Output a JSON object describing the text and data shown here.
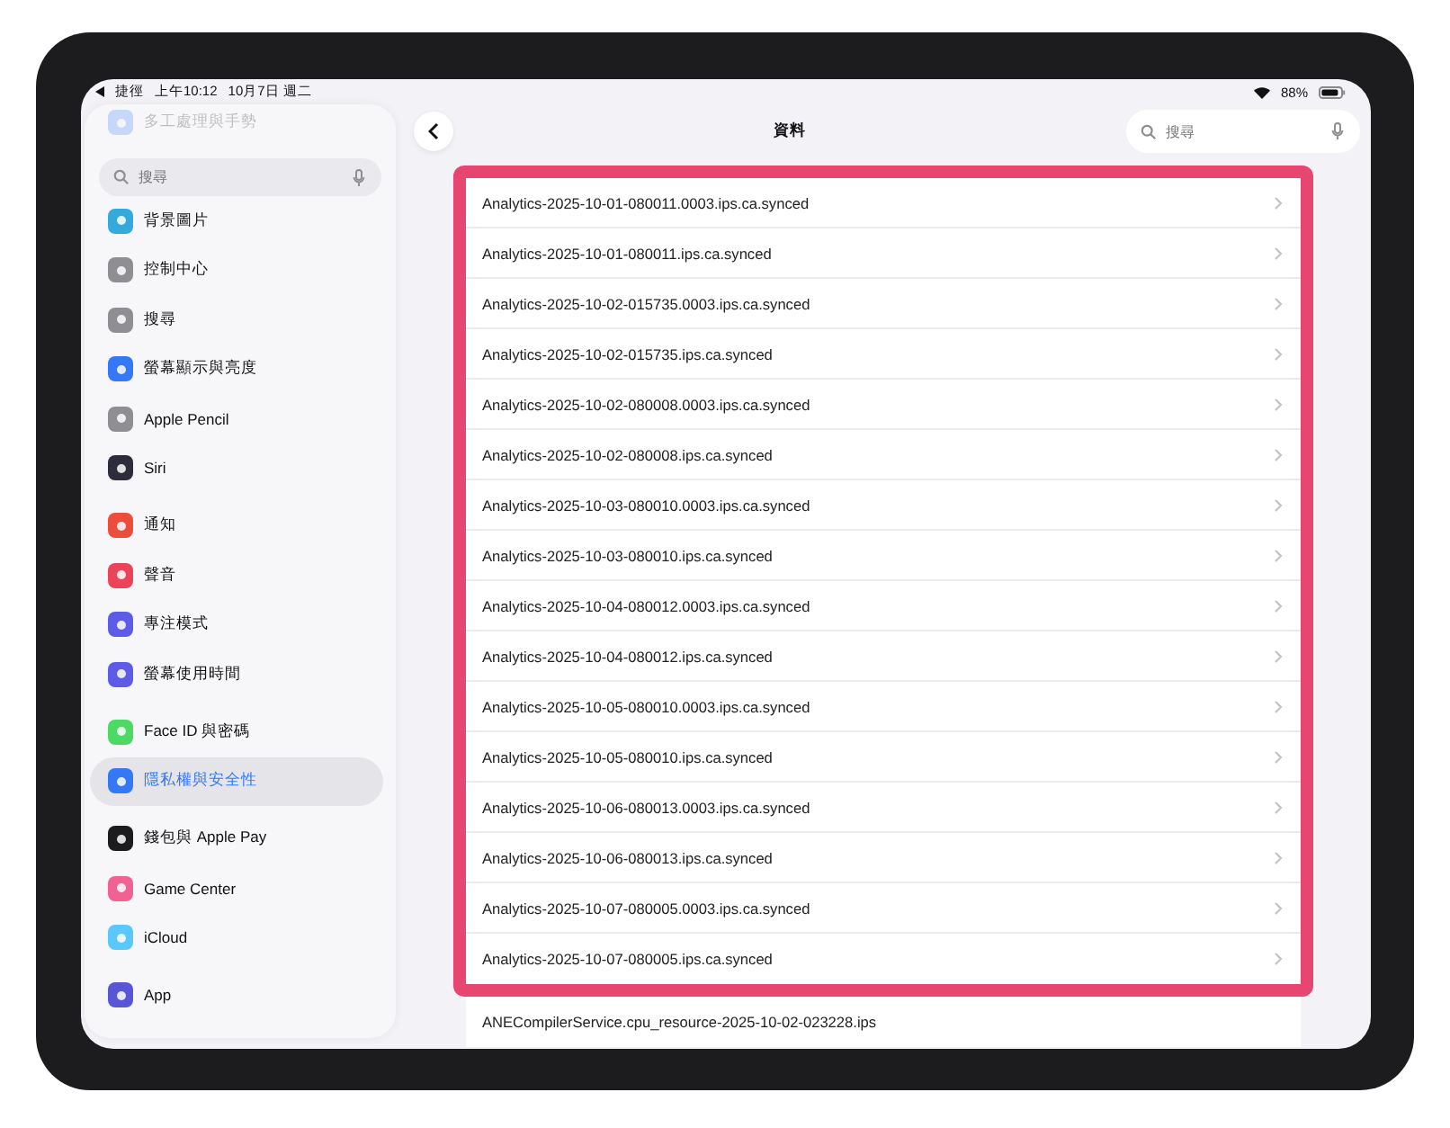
{
  "status_bar": {
    "back_app": "捷徑",
    "time": "上午10:12",
    "date": "10月7日 週二",
    "battery": "88%"
  },
  "sidebar": {
    "search": {
      "placeholder": "搜尋"
    },
    "faded_items": [
      {
        "label": "多工處理與手勢"
      }
    ],
    "groups": [
      [
        {
          "label": "背景圖片",
          "color": "#34aadc",
          "selected": false
        },
        {
          "label": "控制中心",
          "color": "#8e8e93",
          "selected": false
        },
        {
          "label": "搜尋",
          "color": "#8e8e93",
          "selected": false
        },
        {
          "label": "螢幕顯示與亮度",
          "color": "#3478f6",
          "selected": false
        },
        {
          "label": "Apple Pencil",
          "color": "#8e8e93",
          "selected": false
        },
        {
          "label": "Siri",
          "color": "#2c2c3a",
          "selected": false
        }
      ],
      [
        {
          "label": "通知",
          "color": "#eb4e3d",
          "selected": false
        },
        {
          "label": "聲音",
          "color": "#eb445a",
          "selected": false
        },
        {
          "label": "專注模式",
          "color": "#5e5ce6",
          "selected": false
        },
        {
          "label": "螢幕使用時間",
          "color": "#5e5ce6",
          "selected": false
        }
      ],
      [
        {
          "label": "Face ID 與密碼",
          "color": "#4cd964",
          "selected": false
        },
        {
          "label": "隱私權與安全性",
          "color": "#3478f6",
          "selected": true
        }
      ],
      [
        {
          "label": "錢包與 Apple Pay",
          "color": "#1c1c1e",
          "selected": false
        },
        {
          "label": "Game Center",
          "color": "#f06292",
          "selected": false
        },
        {
          "label": "iCloud",
          "color": "#5ac8fa",
          "selected": false
        }
      ],
      [
        {
          "label": "App",
          "color": "#5856d6",
          "selected": false
        }
      ]
    ]
  },
  "nav": {
    "title": "資料",
    "search": {
      "placeholder": "搜尋"
    }
  },
  "highlighted_files": [
    "Analytics-2025-10-01-080011.0003.ips.ca.synced",
    "Analytics-2025-10-01-080011.ips.ca.synced",
    "Analytics-2025-10-02-015735.0003.ips.ca.synced",
    "Analytics-2025-10-02-015735.ips.ca.synced",
    "Analytics-2025-10-02-080008.0003.ips.ca.synced",
    "Analytics-2025-10-02-080008.ips.ca.synced",
    "Analytics-2025-10-03-080010.0003.ips.ca.synced",
    "Analytics-2025-10-03-080010.ips.ca.synced",
    "Analytics-2025-10-04-080012.0003.ips.ca.synced",
    "Analytics-2025-10-04-080012.ips.ca.synced",
    "Analytics-2025-10-05-080010.0003.ips.ca.synced",
    "Analytics-2025-10-05-080010.ips.ca.synced",
    "Analytics-2025-10-06-080013.0003.ips.ca.synced",
    "Analytics-2025-10-06-080013.ips.ca.synced",
    "Analytics-2025-10-07-080005.0003.ips.ca.synced",
    "Analytics-2025-10-07-080005.ips.ca.synced"
  ],
  "other_files": [
    "ANECompilerService.cpu_resource-2025-10-02-023228.ips"
  ]
}
